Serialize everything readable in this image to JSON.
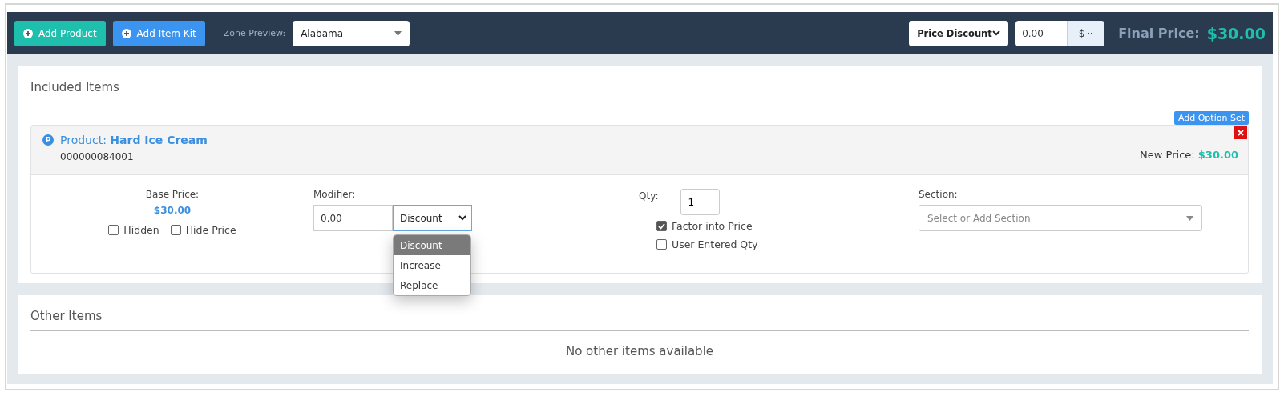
{
  "toolbar": {
    "buttons": [
      {
        "label": "Add Product",
        "kind": "teal"
      },
      {
        "label": "Add Item Kit",
        "kind": "blue"
      }
    ],
    "zone_preview": {
      "label": "Zone Preview:",
      "value": "Alabama"
    },
    "adjustment_type": "Price Discount",
    "adjustment_amount": "0.00",
    "adjustment_unit": "$",
    "final_price": {
      "label": "Final Price:",
      "value": "$30.00"
    }
  },
  "included_items": {
    "title": "Included Items",
    "add_option_set": "Add Option Set",
    "products": [
      {
        "badge": "P",
        "label": "Product:",
        "name": "Hard Ice Cream",
        "sku": "000000084001",
        "new_price_label": "New Price:",
        "new_price": "$30.00",
        "base_price_label": "Base Price:",
        "base_price": "$30.00",
        "flags": [
          {
            "label": "Hidden",
            "checked": false
          },
          {
            "label": "Hide Price",
            "checked": false
          }
        ],
        "modifier_label": "Modifier:",
        "modifier_value": "0.00",
        "modifier_type": "Discount",
        "modifier_open": true,
        "modifier_options": [
          {
            "label": "Discount",
            "selected": true
          },
          {
            "label": "Increase",
            "selected": false
          },
          {
            "label": "Replace",
            "selected": false
          }
        ],
        "qty_label": "Qty:",
        "qty": "1",
        "qty_options": [
          {
            "label": "Factor into Price",
            "checked": true
          },
          {
            "label": "User Entered Qty",
            "checked": false
          }
        ],
        "section_label": "Section:",
        "section_placeholder": "Select or Add Section"
      }
    ]
  },
  "other_items": {
    "title": "Other Items",
    "empty_message": "No other items available"
  }
}
